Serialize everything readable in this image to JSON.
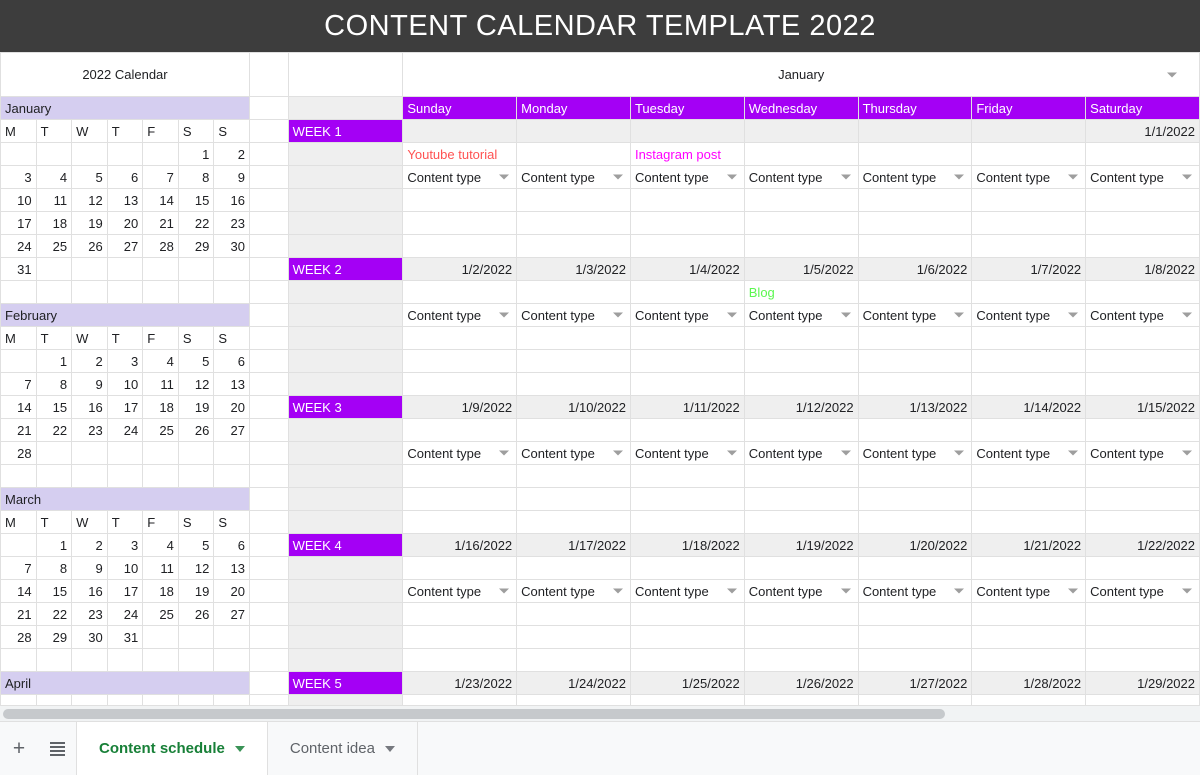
{
  "header": {
    "title": "CONTENT CALENDAR TEMPLATE 2022",
    "bg_color": "#3d3d3d"
  },
  "sidebar": {
    "caption": "2022 Calendar",
    "dow_headers": [
      "M",
      "T",
      "W",
      "T",
      "F",
      "S",
      "S"
    ],
    "months": [
      {
        "name": "January",
        "weeks": [
          [
            "",
            "",
            "",
            "",
            "",
            "1",
            "2"
          ],
          [
            "3",
            "4",
            "5",
            "6",
            "7",
            "8",
            "9"
          ],
          [
            "10",
            "11",
            "12",
            "13",
            "14",
            "15",
            "16"
          ],
          [
            "17",
            "18",
            "19",
            "20",
            "21",
            "22",
            "23"
          ],
          [
            "24",
            "25",
            "26",
            "27",
            "28",
            "29",
            "30"
          ],
          [
            "31",
            "",
            "",
            "",
            "",
            "",
            ""
          ]
        ]
      },
      {
        "name": "February",
        "weeks": [
          [
            "",
            "1",
            "2",
            "3",
            "4",
            "5",
            "6"
          ],
          [
            "7",
            "8",
            "9",
            "10",
            "11",
            "12",
            "13"
          ],
          [
            "14",
            "15",
            "16",
            "17",
            "18",
            "19",
            "20"
          ],
          [
            "21",
            "22",
            "23",
            "24",
            "25",
            "26",
            "27"
          ],
          [
            "28",
            "",
            "",
            "",
            "",
            "",
            ""
          ]
        ]
      },
      {
        "name": "March",
        "weeks": [
          [
            "",
            "1",
            "2",
            "3",
            "4",
            "5",
            "6"
          ],
          [
            "7",
            "8",
            "9",
            "10",
            "11",
            "12",
            "13"
          ],
          [
            "14",
            "15",
            "16",
            "17",
            "18",
            "19",
            "20"
          ],
          [
            "21",
            "22",
            "23",
            "24",
            "25",
            "26",
            "27"
          ],
          [
            "28",
            "29",
            "30",
            "31",
            "",
            "",
            ""
          ]
        ]
      },
      {
        "name": "April",
        "weeks": []
      }
    ]
  },
  "main": {
    "month_title": "January",
    "month_dropdown_icon": "chevron-down-icon",
    "day_headers": [
      "Sunday",
      "Monday",
      "Tuesday",
      "Wednesday",
      "Thursday",
      "Friday",
      "Saturday"
    ],
    "content_type_label": "Content type",
    "content_type_icon": "chevron-down-icon",
    "accent_color": "#a400f5",
    "weeks": [
      {
        "label": "WEEK 1",
        "dates": [
          "",
          "",
          "",
          "",
          "",
          "",
          "1/1/2022"
        ],
        "notes": [
          {
            "text": "Youtube tutorial",
            "color": "#ff5252"
          },
          {
            "text": "",
            "color": ""
          },
          {
            "text": "Instagram post",
            "color": "#ff00ff"
          },
          {
            "text": "",
            "color": ""
          },
          {
            "text": "",
            "color": ""
          },
          {
            "text": "",
            "color": ""
          },
          {
            "text": "",
            "color": ""
          }
        ]
      },
      {
        "label": "WEEK 2",
        "dates": [
          "1/2/2022",
          "1/3/2022",
          "1/4/2022",
          "1/5/2022",
          "1/6/2022",
          "1/7/2022",
          "1/8/2022"
        ],
        "notes": [
          {
            "text": "",
            "color": ""
          },
          {
            "text": "",
            "color": ""
          },
          {
            "text": "",
            "color": ""
          },
          {
            "text": "Blog",
            "color": "#5cf750"
          },
          {
            "text": "",
            "color": ""
          },
          {
            "text": "",
            "color": ""
          },
          {
            "text": "",
            "color": ""
          }
        ]
      },
      {
        "label": "WEEK 3",
        "dates": [
          "1/9/2022",
          "1/10/2022",
          "1/11/2022",
          "1/12/2022",
          "1/13/2022",
          "1/14/2022",
          "1/15/2022"
        ],
        "notes": [
          {
            "text": "",
            "color": ""
          },
          {
            "text": "",
            "color": ""
          },
          {
            "text": "",
            "color": ""
          },
          {
            "text": "",
            "color": ""
          },
          {
            "text": "",
            "color": ""
          },
          {
            "text": "",
            "color": ""
          },
          {
            "text": "",
            "color": ""
          }
        ]
      },
      {
        "label": "WEEK 4",
        "dates": [
          "1/16/2022",
          "1/17/2022",
          "1/18/2022",
          "1/19/2022",
          "1/20/2022",
          "1/21/2022",
          "1/22/2022"
        ],
        "notes": [
          {
            "text": "",
            "color": ""
          },
          {
            "text": "",
            "color": ""
          },
          {
            "text": "",
            "color": ""
          },
          {
            "text": "",
            "color": ""
          },
          {
            "text": "",
            "color": ""
          },
          {
            "text": "",
            "color": ""
          },
          {
            "text": "",
            "color": ""
          }
        ]
      },
      {
        "label": "WEEK 5",
        "dates": [
          "1/23/2022",
          "1/24/2022",
          "1/25/2022",
          "1/26/2022",
          "1/27/2022",
          "1/28/2022",
          "1/29/2022"
        ],
        "notes": [
          {
            "text": "",
            "color": ""
          },
          {
            "text": "",
            "color": ""
          },
          {
            "text": "",
            "color": ""
          },
          {
            "text": "",
            "color": ""
          },
          {
            "text": "",
            "color": ""
          },
          {
            "text": "",
            "color": ""
          },
          {
            "text": "",
            "color": ""
          }
        ]
      }
    ]
  },
  "tab_bar": {
    "add_sheet_icon": "plus-icon",
    "all_sheets_icon": "hamburger-menu-icon",
    "tabs": [
      {
        "label": "Content schedule",
        "active": true,
        "color": "#188038"
      },
      {
        "label": "Content idea",
        "active": false,
        "color": "#5f6368"
      }
    ]
  }
}
